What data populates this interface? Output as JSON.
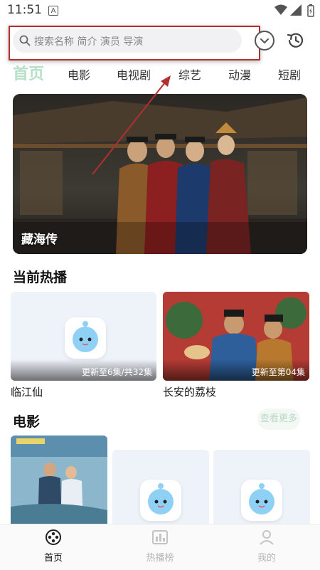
{
  "status_bar": {
    "time": "11:51",
    "notification_icon_letter": "A"
  },
  "search": {
    "placeholder": "搜索名称 简介 演员 导演"
  },
  "tabs": [
    {
      "label": "首页",
      "active": true
    },
    {
      "label": "电影",
      "active": false
    },
    {
      "label": "电视剧",
      "active": false
    },
    {
      "label": "综艺",
      "active": false
    },
    {
      "label": "动漫",
      "active": false
    },
    {
      "label": "短剧",
      "active": false
    }
  ],
  "banner": {
    "title": "藏海传"
  },
  "now_playing": {
    "title": "当前热播",
    "items": [
      {
        "name": "临江仙",
        "badge": "更新至6集/共32集"
      },
      {
        "name": "长安的荔枝",
        "badge": "更新至第04集"
      }
    ]
  },
  "movies": {
    "title": "电影",
    "more_label": "查看更多"
  },
  "bottom_nav": [
    {
      "label": "首页",
      "icon": "film-reel-icon",
      "active": true
    },
    {
      "label": "热播榜",
      "icon": "chart-icon",
      "active": false
    },
    {
      "label": "我的",
      "icon": "user-icon",
      "active": false
    }
  ],
  "colors": {
    "active_tab": "#b6e0c8",
    "annotation": "#b03030"
  }
}
